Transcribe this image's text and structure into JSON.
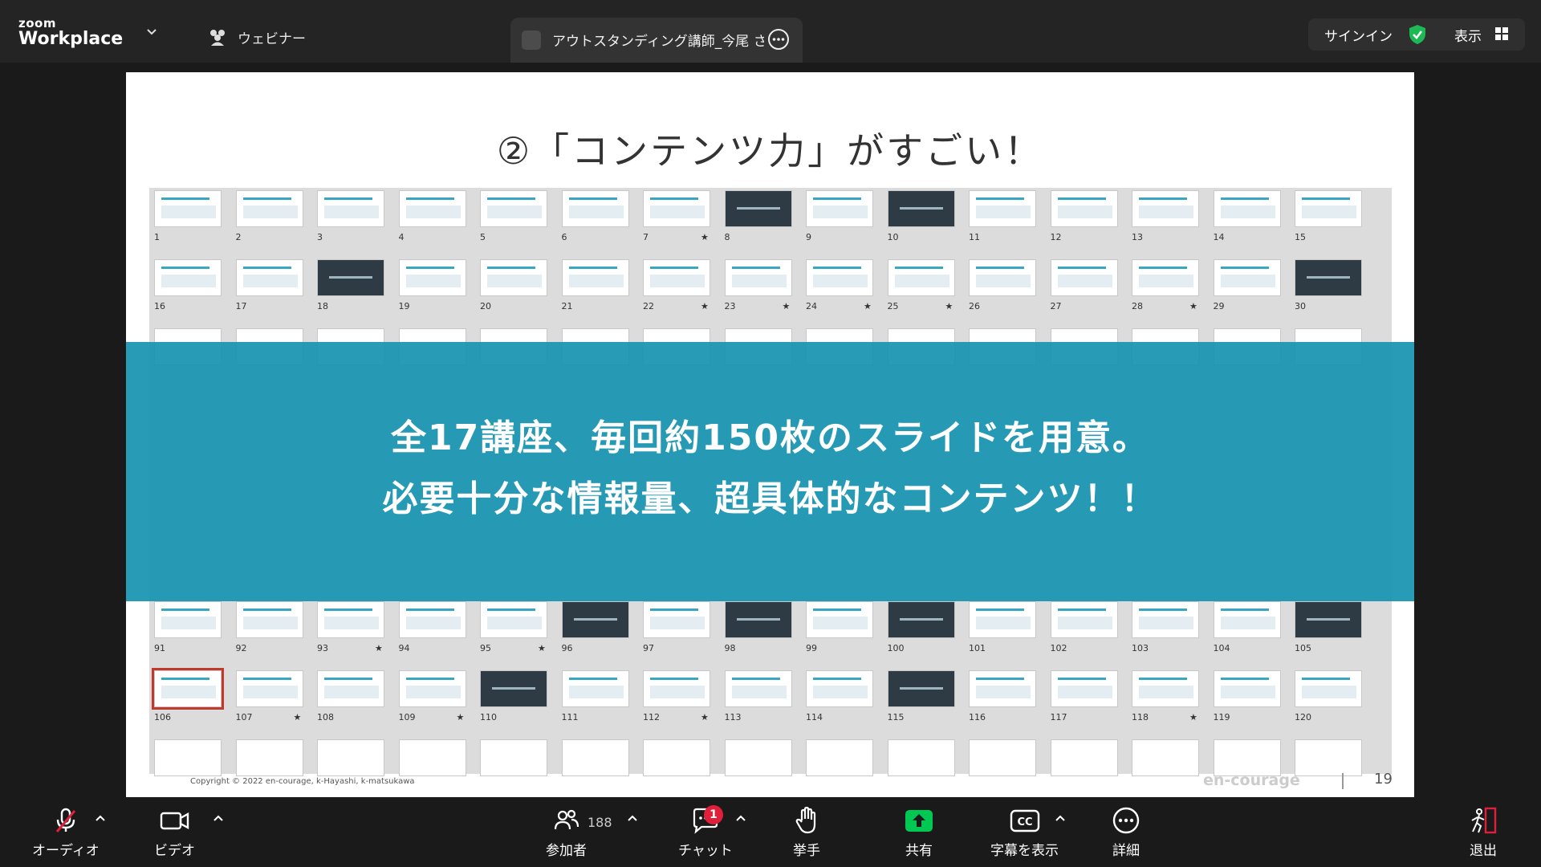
{
  "app": {
    "brand_small": "zoom",
    "brand_big": "Workplace"
  },
  "topbar": {
    "webinar_label": "ウェビナー",
    "meeting_title": "アウトスタンディング講師_今尾 さんの",
    "signin_label": "サインイン",
    "view_label": "表示"
  },
  "slide": {
    "title": "②「コンテンツ力」がすごい！",
    "banner_line1": "全17講座、毎回約150枚のスライドを用意。",
    "banner_line2": "必要十分な情報量、超具体的なコンテンツ！！",
    "copyright": "Copyright © 2022 en-courage, k-Hayashi, k-matsukawa",
    "logo": "en-courage",
    "page_number": "19",
    "thumb_rows_top": [
      {
        "numbers": [
          "1",
          "2",
          "3",
          "4",
          "5",
          "6",
          "7",
          "8",
          "9",
          "10",
          "11",
          "12",
          "13",
          "14",
          "15"
        ],
        "dark": [
          false,
          false,
          false,
          false,
          false,
          false,
          false,
          true,
          false,
          true,
          false,
          false,
          false,
          false,
          false
        ],
        "stars": [
          "7"
        ]
      },
      {
        "numbers": [
          "16",
          "17",
          "18",
          "19",
          "20",
          "21",
          "22",
          "23",
          "24",
          "25",
          "26",
          "27",
          "28",
          "29",
          "30"
        ],
        "dark": [
          false,
          false,
          true,
          false,
          false,
          false,
          false,
          false,
          false,
          false,
          false,
          false,
          false,
          false,
          true
        ],
        "stars": [
          "22",
          "23",
          "24",
          "25",
          "28"
        ]
      }
    ],
    "thumb_rows_bottom": [
      {
        "numbers": [
          "91",
          "92",
          "93",
          "94",
          "95",
          "96",
          "97",
          "98",
          "99",
          "100",
          "101",
          "102",
          "103",
          "104",
          "105"
        ],
        "dark": [
          false,
          false,
          false,
          false,
          false,
          true,
          false,
          true,
          false,
          true,
          false,
          false,
          false,
          false,
          true
        ],
        "stars": [
          "93",
          "95"
        ]
      },
      {
        "numbers": [
          "106",
          "107",
          "108",
          "109",
          "110",
          "111",
          "112",
          "113",
          "114",
          "115",
          "116",
          "117",
          "118",
          "119",
          "120"
        ],
        "dark": [
          false,
          false,
          false,
          false,
          true,
          false,
          false,
          false,
          false,
          true,
          false,
          false,
          false,
          false,
          false
        ],
        "stars": [
          "107",
          "109",
          "112",
          "118"
        ]
      }
    ]
  },
  "toolbar": {
    "audio": "オーディオ",
    "video": "ビデオ",
    "participants": "参加者",
    "participants_count": "188",
    "chat": "チャット",
    "chat_badge": "1",
    "raise_hand": "挙手",
    "share": "共有",
    "captions": "字幕を表示",
    "more": "詳細",
    "leave": "退出"
  },
  "colors": {
    "banner": "#1894b2",
    "share_green": "#00c853",
    "badge_red": "#e0203a"
  }
}
